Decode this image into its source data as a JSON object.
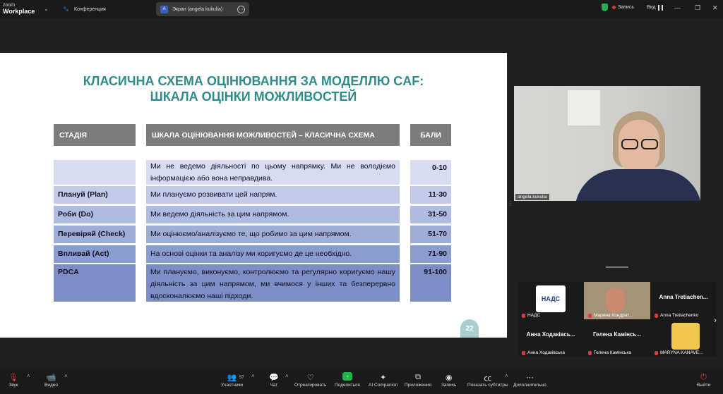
{
  "app": {
    "logo_line1": "zoom",
    "logo_line2": "Workplace"
  },
  "tabs": [
    {
      "label": "Конференция",
      "icon": "paw-icon"
    },
    {
      "label": "Экран (angela.kukulia)",
      "icon_letter": "A"
    }
  ],
  "status": {
    "record_label": "Запись",
    "view_label": "Вид"
  },
  "slide": {
    "title_line1": "КЛАСИЧНА СХЕМА ОЦІНЮВАННЯ ЗА МОДЕЛЛЮ CAF:",
    "title_line2": "ШКАЛА ОЦІНКИ МОЖЛИВОСТЕЙ",
    "headers": [
      "СТАДІЯ",
      "ШКАЛА ОЦІНЮВАННЯ МОЖЛИВОСТЕЙ – КЛАСИЧНА СХЕМА",
      "БАЛИ"
    ],
    "rows": [
      {
        "stage": "",
        "desc": "Ми не ведемо діяльності по цьому напрямку. Ми не володіємо інформацією або вона неправдива.",
        "points": "0-10"
      },
      {
        "stage": "Плануй (Plan)",
        "desc": "Ми плануємо розвивати цей напрям.",
        "points": "11-30"
      },
      {
        "stage": "Роби (Do)",
        "desc": "Ми ведемо діяльність за цим напрямом.",
        "points": "31-50"
      },
      {
        "stage": "Перевіряй (Check)",
        "desc": "Ми оцінюємо/аналізуємо те, що робимо за цим напрямом.",
        "points": "51-70"
      },
      {
        "stage": "Впливай (Act)",
        "desc": "На основі оцінки та аналізу ми коригуємо де це необхідно.",
        "points": "71-90"
      },
      {
        "stage": "PDCA",
        "desc": "Ми плануємо, виконуємо, контролюємо та регулярно коригуємо нашу діяльність за цим напрямом, ми вчимося у інших та безперервно вдосконалюємо наші підходи.",
        "points": "91-100"
      }
    ],
    "page_number": "22"
  },
  "speaker": {
    "name": "angela.kukulia"
  },
  "gallery": [
    {
      "label": "НАДС",
      "display": "НАДС"
    },
    {
      "label": "Марина Кондрат..."
    },
    {
      "label": "Anna Tretiachenko",
      "display": "Anna Tretiachen..."
    },
    {
      "label": "Анна Ходаківська",
      "display": "Анна Ходаківсь..."
    },
    {
      "label": "Гелена Камінська",
      "display": "Гелена Камінсь..."
    },
    {
      "label": "MARYNA KANAVE..."
    }
  ],
  "toolbar": {
    "audio": "Звук",
    "video": "Видео",
    "participants": "Участники",
    "participants_count": "57",
    "chat": "Чат",
    "react": "Отреагировать",
    "share": "Поделиться",
    "ai": "AI Companion",
    "apps": "Приложения",
    "record": "Запись",
    "captions": "Показать субтитры",
    "more": "Дополнительно",
    "leave": "Выйти"
  }
}
